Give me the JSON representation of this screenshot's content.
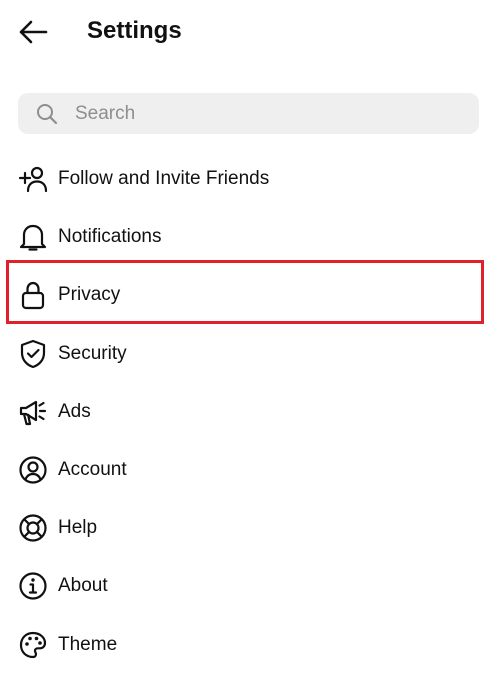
{
  "header": {
    "title": "Settings",
    "back_icon": "arrow-left-icon"
  },
  "search": {
    "placeholder": "Search",
    "value": "",
    "icon": "search-icon"
  },
  "menu": {
    "items": [
      {
        "label": "Follow and Invite Friends",
        "icon": "add-person-icon"
      },
      {
        "label": "Notifications",
        "icon": "bell-icon"
      },
      {
        "label": "Privacy",
        "icon": "lock-icon",
        "highlighted": true
      },
      {
        "label": "Security",
        "icon": "shield-check-icon"
      },
      {
        "label": "Ads",
        "icon": "megaphone-icon"
      },
      {
        "label": "Account",
        "icon": "user-circle-icon"
      },
      {
        "label": "Help",
        "icon": "lifebuoy-icon"
      },
      {
        "label": "About",
        "icon": "info-icon"
      },
      {
        "label": "Theme",
        "icon": "palette-icon"
      }
    ]
  },
  "colors": {
    "highlight_border": "#e0202a",
    "search_background": "#efefef",
    "text": "#111111",
    "placeholder": "#8e8e8e"
  }
}
